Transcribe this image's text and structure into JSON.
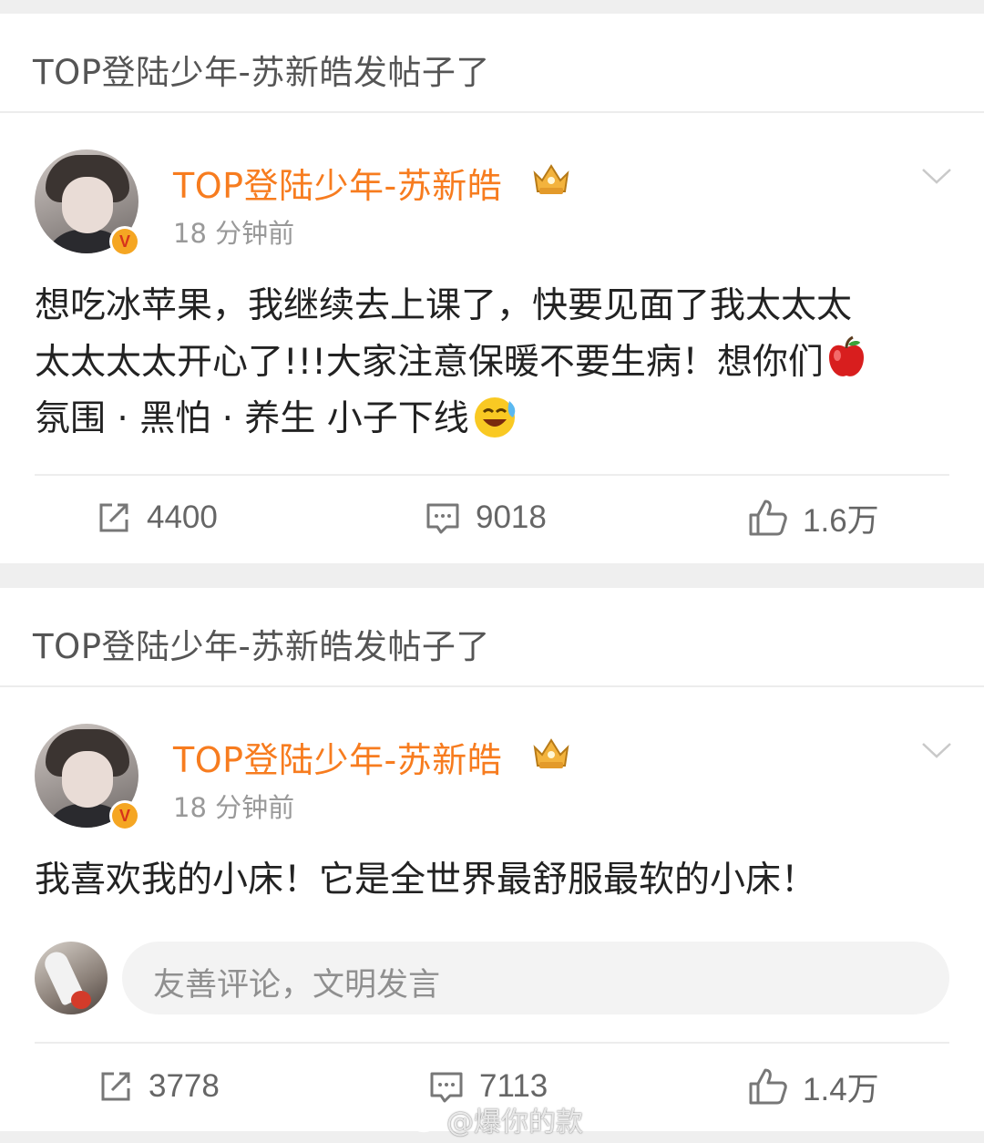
{
  "posts": [
    {
      "notice": "TOP登陆少年-苏新皓发帖子了",
      "username": "TOP登陆少年-苏新皓",
      "time": "18 分钟前",
      "text_line1": "想吃冰苹果，我继续去上课了，快要见面了我太太太",
      "text_line2": "太太太太开心了!!!大家注意保暖不要生病！想你们",
      "text_line3": "氛围 · 黑怕 · 养生 小子下线",
      "reposts": "4400",
      "comments": "9018",
      "likes": "1.6万"
    },
    {
      "notice": "TOP登陆少年-苏新皓发帖子了",
      "username": "TOP登陆少年-苏新皓",
      "time": "18 分钟前",
      "text_line1": "我喜欢我的小床！它是全世界最舒服最软的小床！",
      "comment_placeholder": "友善评论，文明发言",
      "reposts": "3778",
      "comments": "7113",
      "likes": "1.4万"
    }
  ],
  "watermark": "@爆你的款",
  "colors": {
    "username": "#f77c1f",
    "badge": "#f5a623",
    "text": "#222222",
    "meta": "#999999"
  }
}
